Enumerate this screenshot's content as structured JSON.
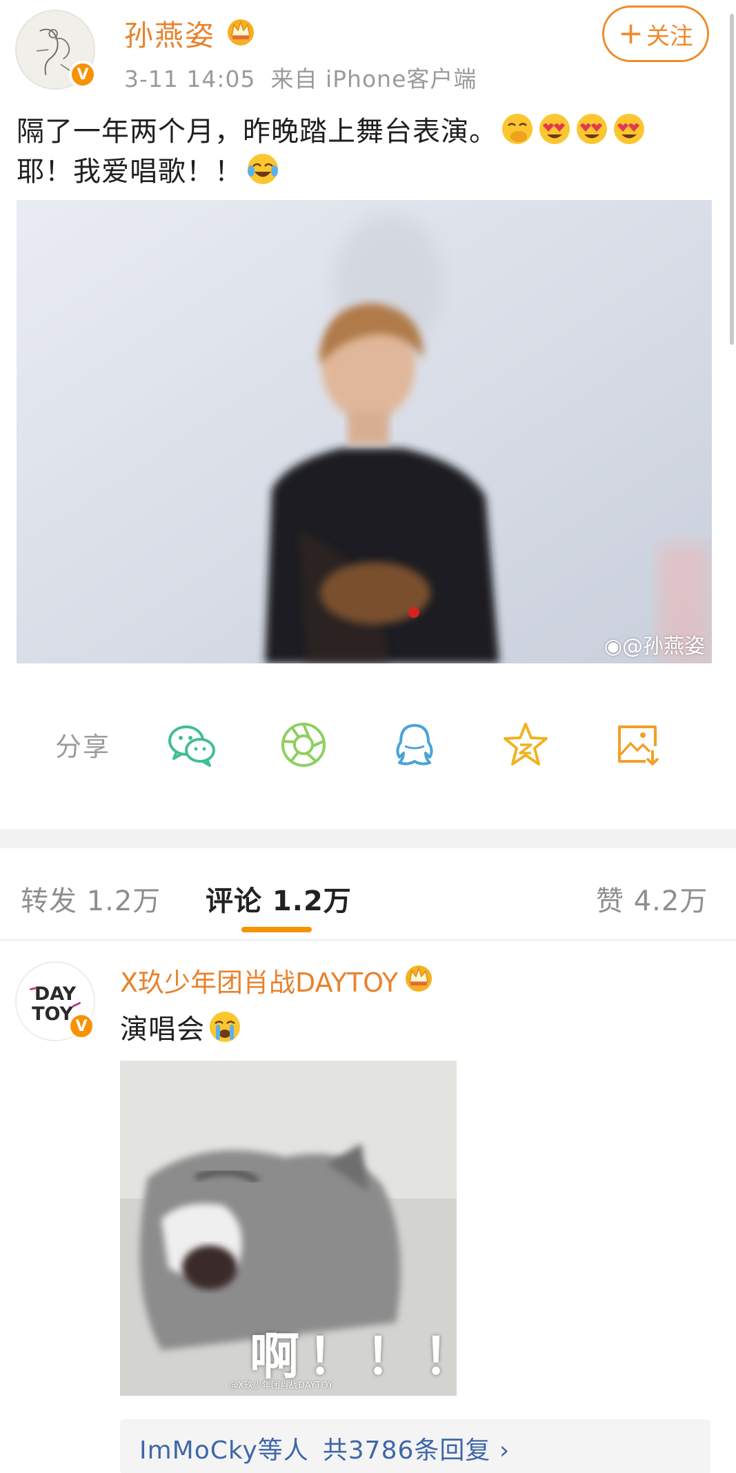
{
  "post": {
    "author": "孙燕姿",
    "time": "3-11 14:05",
    "source": "来自 iPhone客户端",
    "follow_label": "关注",
    "follow_plus": "+",
    "text_line1": "隔了一年两个月，昨晚踏上舞台表演。",
    "text_line2": "耶！我爱唱歌！！",
    "image_watermark": "@孙燕姿",
    "verified_badge": "V"
  },
  "share": {
    "label": "分享",
    "icons": [
      "wechat-icon",
      "moments-icon",
      "qq-icon",
      "qzone-icon",
      "save-image-icon"
    ],
    "icon_colors": {
      "wechat": "#3fbf8f",
      "moments": "#8fcf5f",
      "qq": "#4aa3d8",
      "qzone": "#f1b21e",
      "save": "#f1a02a"
    }
  },
  "tabs": {
    "repost": "转发 1.2万",
    "comment": "评论 1.2万",
    "like": "赞 4.2万"
  },
  "comment": {
    "author": "X玖少年团肖战DAYTOY",
    "avatar_text_top": "DAY",
    "avatar_text_bottom": "TOY",
    "text": "演唱会",
    "image_caption": "啊！！！",
    "image_watermark": "@X玖少年团肖战DAYTOY",
    "replies_users": "ImMoCky等人",
    "replies_count": "共3786条回复 ›"
  },
  "colors": {
    "accent": "#f79205",
    "author": "#e8822c",
    "link": "#3f66a8"
  }
}
